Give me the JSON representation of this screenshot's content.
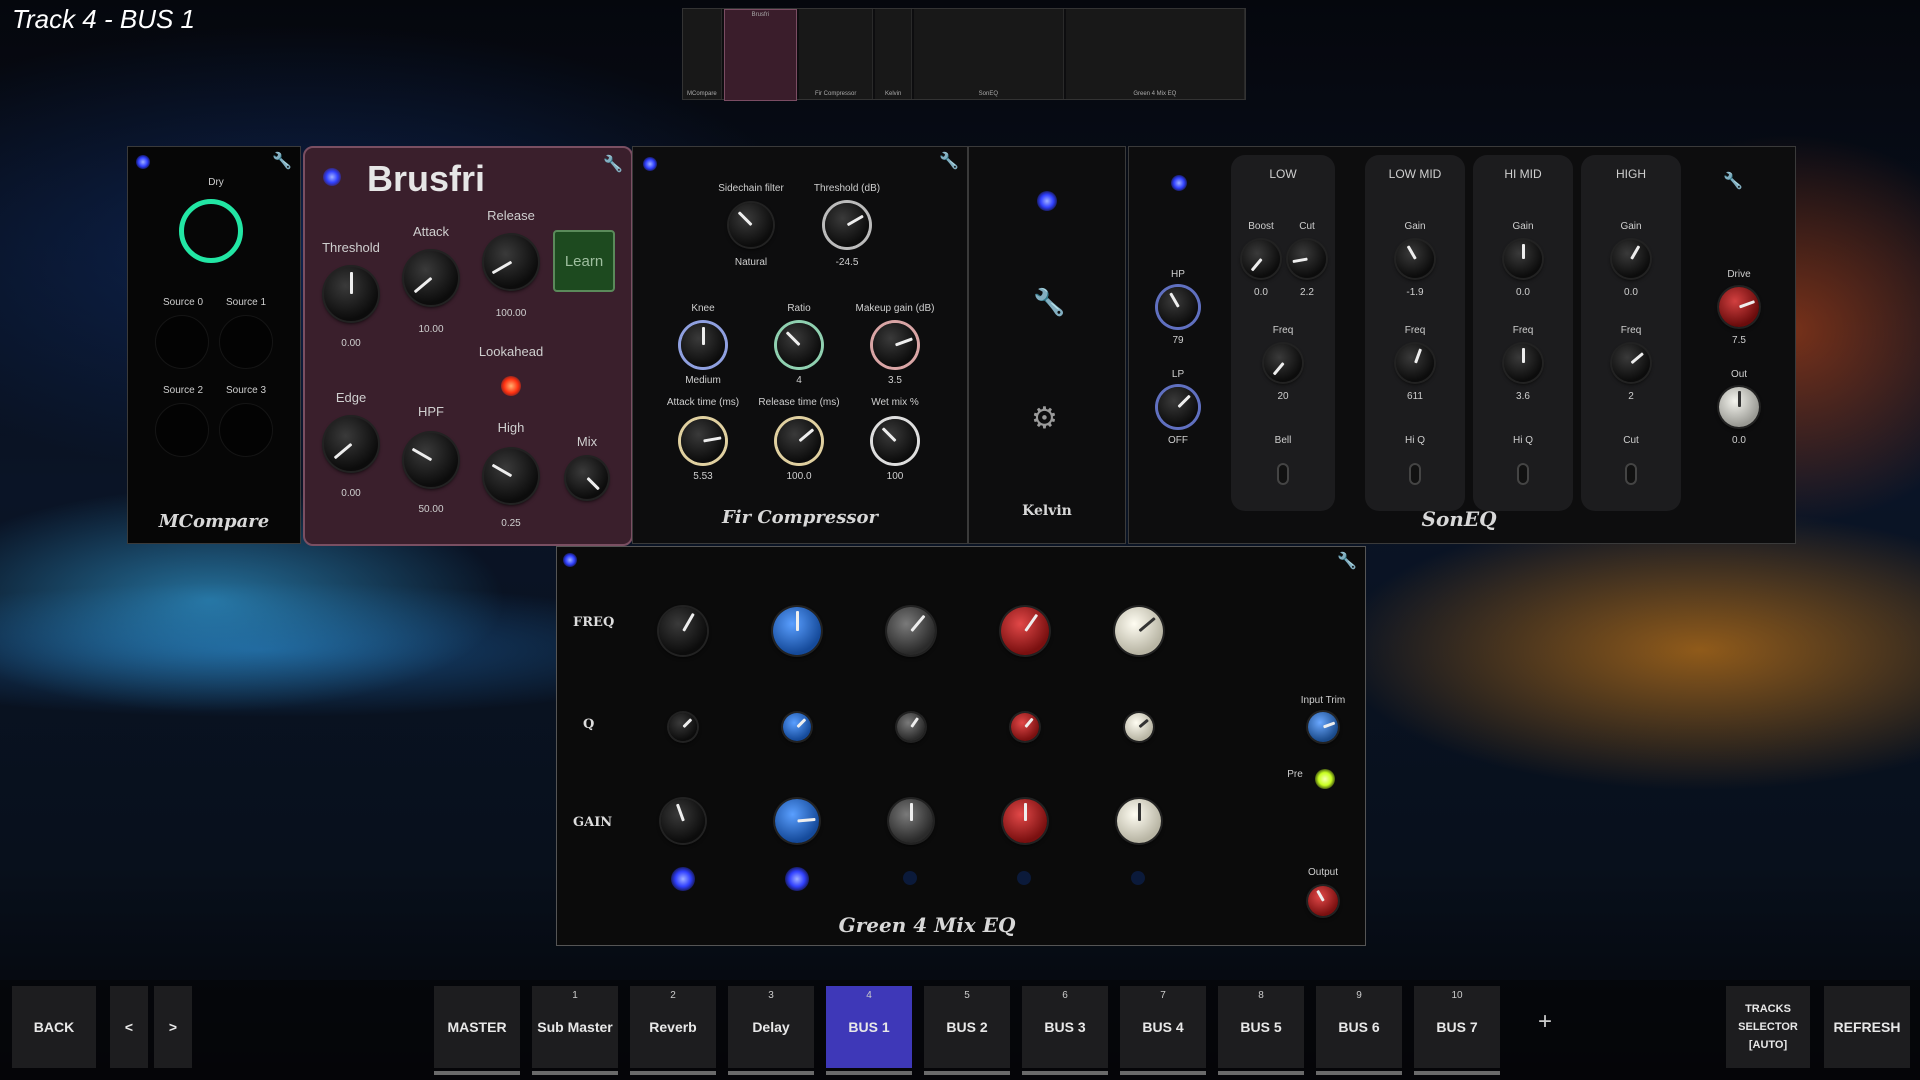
{
  "track_title": "Track 4 - BUS 1",
  "thumbnails": [
    "MCompare",
    "Brusfri",
    "Fir Compressor",
    "Kelvin",
    "SonEQ",
    "Green 4 Mix EQ"
  ],
  "mcompare": {
    "name": "MCompare",
    "dry_label": "Dry",
    "sources": [
      "Source 0",
      "Source 1",
      "Source 2",
      "Source 3"
    ]
  },
  "brusfri": {
    "name": "Brusfri",
    "learn_label": "Learn",
    "lookahead_label": "Lookahead",
    "knobs": [
      {
        "label": "Threshold",
        "value": "0.00"
      },
      {
        "label": "Attack",
        "value": "10.00"
      },
      {
        "label": "Release",
        "value": "100.00"
      },
      {
        "label": "Edge",
        "value": "0.00"
      },
      {
        "label": "HPF",
        "value": "50.00"
      },
      {
        "label": "High",
        "value": "0.25"
      },
      {
        "label": "Mix",
        "value": ""
      }
    ]
  },
  "fir": {
    "name": "Fir Compressor",
    "knobs": [
      {
        "label": "Sidechain filter",
        "value": "Natural"
      },
      {
        "label": "Threshold (dB)",
        "value": "-24.5"
      },
      {
        "label": "Knee",
        "value": "Medium"
      },
      {
        "label": "Ratio",
        "value": "4"
      },
      {
        "label": "Makeup gain (dB)",
        "value": "3.5"
      },
      {
        "label": "Attack time (ms)",
        "value": "5.53"
      },
      {
        "label": "Release time (ms)",
        "value": "100.0"
      },
      {
        "label": "Wet mix %",
        "value": "100"
      }
    ]
  },
  "kelvin": {
    "name": "Kelvin"
  },
  "soneq": {
    "name": "SonEQ",
    "hp_label": "HP",
    "hp_value": "79",
    "lp_label": "LP",
    "lp_value": "OFF",
    "bands": [
      {
        "title": "LOW",
        "k1": "Boost",
        "v1": "0.0",
        "k1b": "Cut",
        "v1b": "2.2",
        "k2": "Freq",
        "v2": "20",
        "sw": "Bell"
      },
      {
        "title": "LOW MID",
        "k1": "Gain",
        "v1": "-1.9",
        "k2": "Freq",
        "v2": "611",
        "sw": "Hi Q"
      },
      {
        "title": "HI MID",
        "k1": "Gain",
        "v1": "0.0",
        "k2": "Freq",
        "v2": "3.6",
        "sw": "Hi Q"
      },
      {
        "title": "HIGH",
        "k1": "Gain",
        "v1": "0.0",
        "k2": "Freq",
        "v2": "2",
        "sw": "Cut"
      }
    ],
    "drive_label": "Drive",
    "drive_value": "7.5",
    "out_label": "Out",
    "out_value": "0.0"
  },
  "green": {
    "name": "Green 4 Mix EQ",
    "row_freq": "FREQ",
    "row_q": "Q",
    "row_gain": "GAIN",
    "input_trim": "Input Trim",
    "pre": "Pre",
    "output": "Output"
  },
  "nav": {
    "back": "BACK",
    "prev": "<",
    "next": ">",
    "tracks": [
      {
        "num": "",
        "label": "MASTER"
      },
      {
        "num": "1",
        "label": "Sub Master"
      },
      {
        "num": "2",
        "label": "Reverb"
      },
      {
        "num": "3",
        "label": "Delay"
      },
      {
        "num": "4",
        "label": "BUS 1"
      },
      {
        "num": "5",
        "label": "BUS 2"
      },
      {
        "num": "6",
        "label": "BUS 3"
      },
      {
        "num": "7",
        "label": "BUS 4"
      },
      {
        "num": "8",
        "label": "BUS 5"
      },
      {
        "num": "9",
        "label": "BUS 6"
      },
      {
        "num": "10",
        "label": "BUS 7"
      }
    ],
    "add": "+",
    "tracks_selector": [
      "TRACKS",
      "SELECTOR",
      "[AUTO]"
    ],
    "refresh": "REFRESH"
  }
}
